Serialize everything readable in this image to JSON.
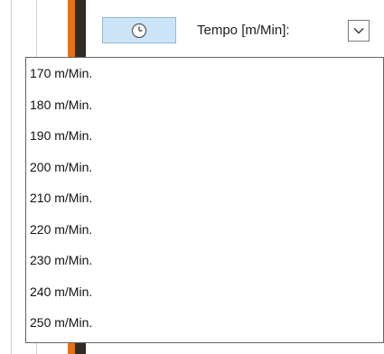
{
  "toolbar": {
    "clock_icon": "clock-icon",
    "tempo_label": "Tempo [m/Min]:",
    "dropdown_icon": "chevron-down-icon"
  },
  "tempo_options": [
    "170 m/Min.",
    "180 m/Min.",
    "190 m/Min.",
    "200 m/Min.",
    "210 m/Min.",
    "220 m/Min.",
    "230 m/Min.",
    "240 m/Min.",
    "250 m/Min."
  ],
  "colors": {
    "accent_orange": "#ee6f10",
    "button_fill": "#cce4f7",
    "gridline": "#c7d8c2"
  }
}
